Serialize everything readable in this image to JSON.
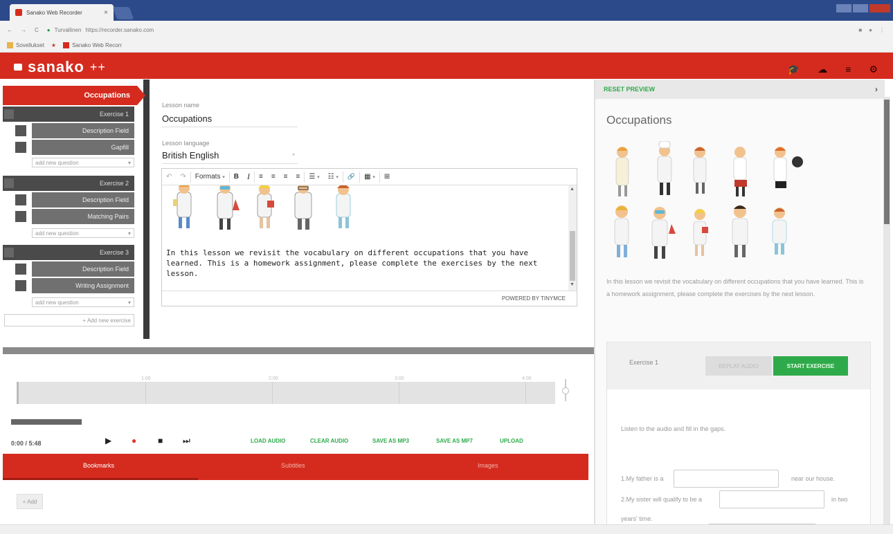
{
  "browser": {
    "tab_title": "Sanako Web Recorder",
    "tab_close": "×",
    "nav_back": "←",
    "nav_forward": "→",
    "nav_reload": "C",
    "lock": "●",
    "secure_label": "Turvallinen",
    "url": "https://recorder.sanako.com",
    "bookmarks": [
      {
        "label": "Sovellukset"
      },
      {
        "label": "Sanako Web Recorr"
      }
    ],
    "bookmark_star": "★"
  },
  "app": {
    "logo_text": "sanako",
    "logo_plus": "++",
    "header_icons": [
      "graduation-cap-icon",
      "cloud-icon",
      "list-icon",
      "gear-icon"
    ],
    "header_glyphs": [
      "🎓",
      "☁",
      "≡",
      "⚙"
    ]
  },
  "sidebar": {
    "active_lesson": "Occupations",
    "exercises": [
      {
        "title": "Exercise 1",
        "items": [
          "Description Field",
          "Gapfill"
        ],
        "add_question": "add new question"
      },
      {
        "title": "Exercise 2",
        "items": [
          "Description Field",
          "Matching Pairs"
        ],
        "add_question": "add new question"
      },
      {
        "title": "Exercise 3",
        "items": [
          "Description Field",
          "Writing Assignment"
        ],
        "add_question": "add new question"
      }
    ],
    "add_exercise": "+ Add new exercise",
    "caret": "▾"
  },
  "form": {
    "lesson_name_label": "Lesson name",
    "lesson_name_value": "Occupations",
    "lesson_language_label": "Lesson language",
    "lesson_language_value": "British English",
    "caret": "▾"
  },
  "editor": {
    "toolbar": {
      "undo": "↶",
      "redo": "↷",
      "formats": "Formats",
      "caret": "▾",
      "bold": "B",
      "italic": "I",
      "align_left": "≡",
      "align_center": "≡",
      "align_right": "≡",
      "justify": "≡",
      "bullet_list": "☰",
      "numbered_list": "☷",
      "link": "🔗",
      "table": "▦",
      "media": "⊞"
    },
    "body_text": "In this lesson we revisit the vocabulary on different occupations that you have learned. This is a homework assignment, please complete the exercises by the next lesson.",
    "status": "POWERED BY TINYMCE",
    "scroll_up": "▲",
    "scroll_down": "▼"
  },
  "preview": {
    "reset_label": "RESET PREVIEW",
    "collapse_arrow": "›",
    "title": "Occupations",
    "paragraph": "In this lesson we revisit the vocabulary on different occupations that you have learned. This is a homework assignment, please complete the exercises by the next lesson.",
    "exercise_label": "Exercise 1",
    "replay_audio": "REPLAY AUDIO",
    "start_exercise": "START EXERCISE",
    "instructions": "Listen to the audio and fill in the gaps.",
    "q1_before": "1.My father is a",
    "q1_after": "near our house.",
    "q2_before": "2.My sister will qualify to be a",
    "q2_after": "in two",
    "q2_cont": "years' time."
  },
  "audio": {
    "ticks": [
      "1:00",
      "2:00",
      "3:00",
      "4:00"
    ],
    "time": "0:00 / 5:48",
    "controls": [
      "▶",
      "●",
      "■",
      "⏭"
    ],
    "actions": [
      "LOAD AUDIO",
      "CLEAR AUDIO",
      "SAVE AS MP3",
      "SAVE AS MP7",
      "UPLOAD"
    ],
    "tabs": [
      "Bookmarks",
      "Subtitles",
      "Images"
    ],
    "add_label": "+ Add"
  },
  "colors": {
    "brand_red": "#d52b1e",
    "accent_green": "#2eaa4a",
    "sidebar_dark": "#4a4a4a"
  }
}
